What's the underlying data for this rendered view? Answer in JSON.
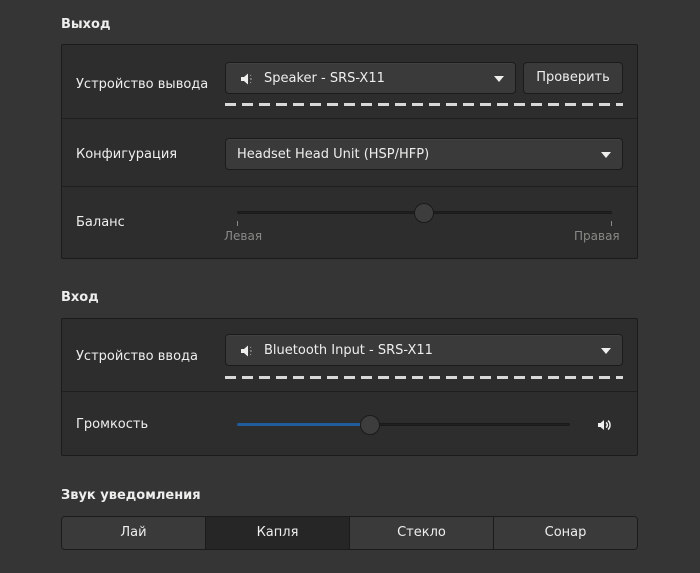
{
  "output": {
    "title": "Выход",
    "device_label": "Устройство вывода",
    "device_value": "Speaker - SRS-X11",
    "test_button": "Проверить",
    "config_label": "Конфигурация",
    "config_value": "Headset Head Unit (HSP/HFP)",
    "balance_label": "Баланс",
    "balance_left": "Левая",
    "balance_right": "Правая",
    "balance_level": 0.5
  },
  "input": {
    "title": "Вход",
    "device_label": "Устройство ввода",
    "device_value": "Bluetooth Input - SRS-X11",
    "volume_label": "Громкость",
    "volume_level": 0.4
  },
  "alert": {
    "title": "Звук уведомления",
    "options": [
      "Лай",
      "Капля",
      "Стекло",
      "Сонар"
    ],
    "selected": "Капля"
  },
  "icons": {
    "output_device": "speaker-icon",
    "input_device": "speaker-icon",
    "volume": "volume-high-icon",
    "dropdown": "chevron-down-icon"
  },
  "colors": {
    "background": "#353535",
    "frame": "#2d2d2d",
    "accent": "#215d9c"
  }
}
